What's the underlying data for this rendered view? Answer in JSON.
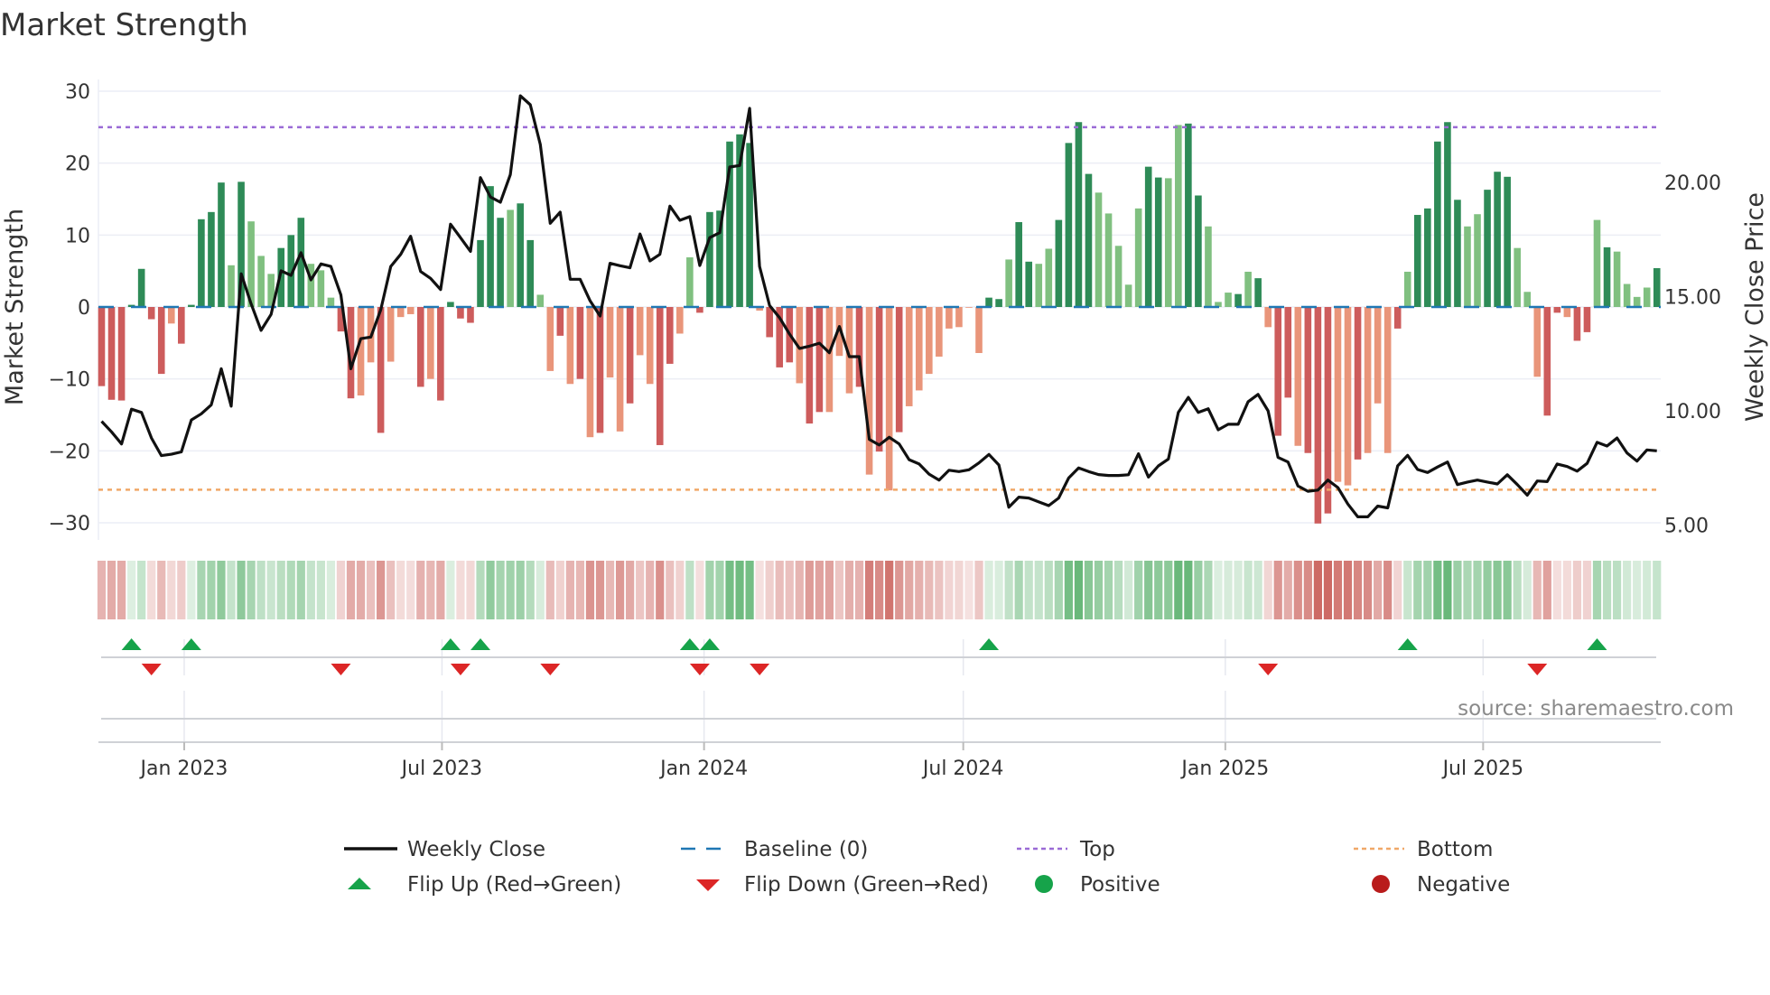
{
  "title": "Market Strength",
  "source": "source: sharemaestro.com",
  "colors": {
    "bar_pos_dark": "#2e8b57",
    "bar_pos_light": "#80c080",
    "bar_neg_dark": "#cd5c5c",
    "bar_neg_light": "#e9957a",
    "price_line": "#111111",
    "baseline": "#1f77b4",
    "top": "#9b6bd6",
    "bottom": "#f0a868",
    "flip_up": "#16a34a",
    "flip_down": "#dc2626",
    "positive": "#16a34a",
    "negative": "#b91c1c",
    "grid": "#eceef5"
  },
  "chart_data": {
    "type": "bar",
    "title": "Market Strength",
    "ylabel": "Market Strength",
    "y2label": "Weekly Close Price",
    "ylim": [
      -32,
      32
    ],
    "y2lim": [
      4.8,
      25.9
    ],
    "yticks": [
      30,
      20,
      10,
      0,
      -10,
      -20,
      -30
    ],
    "ytick_labels": [
      "30",
      "20",
      "10",
      "0",
      "−10",
      "−20",
      "−30"
    ],
    "y2ticks": [
      20,
      15,
      10,
      5
    ],
    "y2tick_labels": [
      "20.00",
      "15.00",
      "10.00",
      "5.00"
    ],
    "x_start": "2022-11-04",
    "x_freq": "weekly",
    "xticks": [
      {
        "date": "2023-01-01",
        "label": "Jan 2023"
      },
      {
        "date": "2023-07-01",
        "label": "Jul 2023"
      },
      {
        "date": "2024-01-01",
        "label": "Jan 2024"
      },
      {
        "date": "2024-07-01",
        "label": "Jul 2024"
      },
      {
        "date": "2025-01-01",
        "label": "Jan 2025"
      },
      {
        "date": "2025-07-01",
        "label": "Jul 2025"
      }
    ],
    "thresholds": {
      "top": 25,
      "bottom": -25.4,
      "baseline": 0
    },
    "strength": [
      -11.0,
      -12.9,
      -13.0,
      0.3,
      5.3,
      -1.7,
      -9.3,
      -2.3,
      -5.1,
      0.3,
      12.2,
      13.2,
      17.3,
      5.8,
      17.4,
      11.9,
      7.1,
      4.6,
      8.2,
      10.0,
      12.4,
      6.0,
      5.1,
      1.3,
      -3.4,
      -12.7,
      -12.3,
      -7.7,
      -17.5,
      -7.6,
      -1.4,
      -1.0,
      -11.1,
      -10.0,
      -13.0,
      0.7,
      -1.6,
      -2.2,
      9.3,
      16.8,
      12.4,
      13.5,
      14.4,
      9.3,
      1.7,
      -8.9,
      -4.0,
      -10.7,
      -10.0,
      -18.1,
      -17.5,
      -9.8,
      -17.3,
      -13.4,
      -6.7,
      -10.7,
      -19.2,
      -7.9,
      -3.7,
      6.9,
      -0.8,
      13.2,
      13.4,
      23.0,
      24.0,
      22.8,
      -0.5,
      -4.2,
      -8.4,
      -7.7,
      -10.6,
      -16.2,
      -14.6,
      -14.6,
      -6.8,
      -12.0,
      -11.1,
      -23.3,
      -20.1,
      -25.5,
      -17.4,
      -13.8,
      -11.6,
      -9.3,
      -6.9,
      -3.0,
      -2.8,
      -0.1,
      -6.4,
      1.3,
      1.1,
      6.6,
      11.8,
      6.3,
      6.0,
      8.1,
      12.1,
      22.8,
      25.7,
      18.5,
      15.9,
      13.0,
      8.5,
      3.1,
      13.7,
      19.5,
      18.0,
      17.9,
      25.3,
      25.5,
      15.5,
      11.2,
      0.7,
      2.0,
      1.8,
      4.9,
      4.0,
      -2.8,
      -17.9,
      -12.6,
      -19.3,
      -20.3,
      -30.1,
      -28.7,
      -24.3,
      -24.8,
      -21.2,
      -20.3,
      -13.4,
      -20.3,
      -3.0,
      4.9,
      12.8,
      13.7,
      23.0,
      25.7,
      14.9,
      11.2,
      12.9,
      16.3,
      18.8,
      18.1,
      8.2,
      2.1,
      -9.7,
      -15.1,
      -0.8,
      -1.4,
      -4.7,
      -3.5,
      12.1,
      8.3,
      7.7,
      3.2,
      1.4,
      2.7,
      5.4
    ],
    "shade": "dddddddldddddldllldddlllddlldllldldddddddlddlldldldlldllddllddddddldddlddllldldldlllllllldd lddllddddlllllddlldd llldldlddldddlldllldldddddlldddlllddlddldlllldd",
    "weekly_close": [
      9.54,
      9.08,
      8.55,
      10.07,
      9.93,
      8.81,
      8.04,
      8.1,
      8.2,
      9.6,
      9.87,
      10.26,
      11.84,
      10.2,
      16.0,
      14.68,
      13.52,
      14.22,
      16.13,
      15.93,
      16.92,
      15.73,
      16.43,
      16.32,
      15.07,
      11.84,
      13.16,
      13.23,
      14.42,
      16.32,
      16.85,
      17.64,
      16.1,
      15.8,
      15.31,
      18.17,
      17.58,
      16.98,
      20.21,
      19.36,
      19.13,
      20.34,
      23.79,
      23.4,
      21.66,
      18.21,
      18.7,
      15.76,
      15.76,
      14.81,
      14.15,
      16.46,
      16.35,
      16.26,
      17.74,
      16.56,
      16.85,
      18.96,
      18.34,
      18.5,
      16.36,
      17.58,
      17.8,
      20.67,
      20.74,
      23.24,
      16.32,
      14.61,
      14.08,
      13.36,
      12.73,
      12.83,
      12.96,
      12.54,
      13.69,
      12.37,
      12.37,
      8.75,
      8.5,
      8.84,
      8.55,
      7.86,
      7.67,
      7.23,
      6.97,
      7.4,
      7.34,
      7.42,
      7.72,
      8.09,
      7.63,
      5.78,
      6.22,
      6.18,
      6.01,
      5.85,
      6.18,
      7.06,
      7.5,
      7.34,
      7.21,
      7.17,
      7.17,
      7.2,
      8.12,
      7.1,
      7.59,
      7.89,
      9.93,
      10.59,
      9.93,
      10.09,
      9.17,
      9.41,
      9.41,
      10.4,
      10.72,
      10.0,
      7.96,
      7.76,
      6.71,
      6.48,
      6.53,
      6.97,
      6.64,
      5.92,
      5.36,
      5.36,
      5.83,
      5.75,
      7.59,
      8.05,
      7.43,
      7.3,
      7.54,
      7.76,
      6.77,
      6.88,
      6.97,
      6.88,
      6.8,
      7.2,
      6.77,
      6.31,
      6.93,
      6.9,
      7.67,
      7.56,
      7.36,
      7.7,
      8.62,
      8.46,
      8.81,
      8.16,
      7.8,
      8.29,
      8.25
    ],
    "legend_position": "bottom",
    "legend": {
      "weekly_close": "Weekly Close",
      "baseline": "Baseline (0)",
      "top": "Top",
      "bottom": "Bottom",
      "flip_up": "Flip Up (Red→Green)",
      "flip_down": "Flip Down (Green→Red)",
      "positive": "Positive",
      "negative": "Negative"
    }
  }
}
